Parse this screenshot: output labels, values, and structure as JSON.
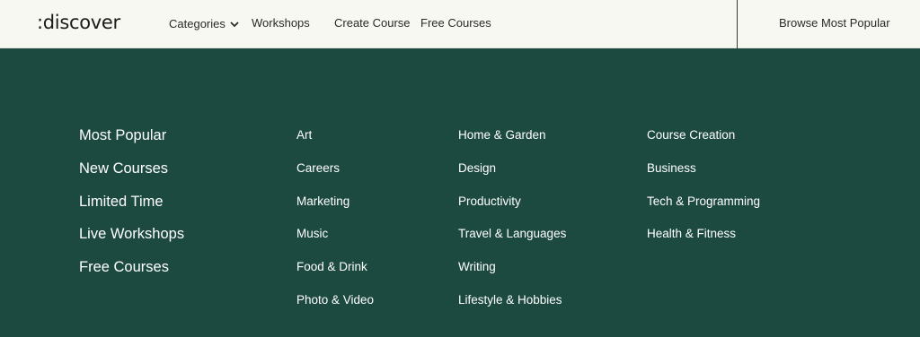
{
  "header": {
    "logo": ":discover",
    "nav": {
      "categories": "Categories",
      "workshops": "Workshops",
      "create_course": "Create Course",
      "free_courses": "Free Courses"
    },
    "browse": "Browse Most Popular"
  },
  "menu": {
    "primary": [
      "Most Popular",
      "New Courses",
      "Limited Time",
      "Live Workshops",
      "Free Courses"
    ],
    "col2": [
      "Art",
      "Careers",
      "Marketing",
      "Music",
      "Food & Drink",
      "Photo & Video"
    ],
    "col3": [
      "Home & Garden",
      "Design",
      "Productivity",
      "Travel & Languages",
      "Writing",
      "Lifestyle & Hobbies"
    ],
    "col4": [
      "Course Creation",
      "Business",
      "Tech & Programming",
      "Health & Fitness"
    ]
  },
  "colors": {
    "header_bg": "#f7f8f2",
    "menu_bg": "#1c4a40",
    "menu_text": "#ffffff"
  }
}
